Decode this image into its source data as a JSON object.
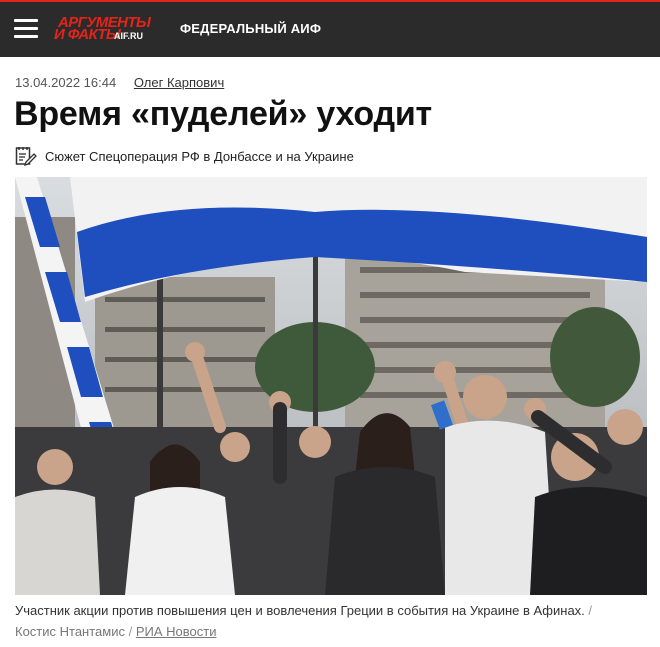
{
  "header": {
    "logo": {
      "line1": "АРГУМЕНТЫ",
      "line2": "И ФАКТЫ",
      "domain": "AIF.RU"
    },
    "section_link": "ФЕДЕРАЛЬНЫЙ АИФ",
    "icons": {
      "menu": "hamburger-menu-icon"
    }
  },
  "article": {
    "date": "13.04.2022 16:44",
    "author": "Олег Карпович",
    "title": "Время «пуделей» уходит",
    "story_label": "Сюжет Спецоперация РФ в Донбассе и на Украине",
    "story_icon": "story-notepad-icon",
    "caption": {
      "text": "Участник акции против повышения цен и вовлечения Греции в события на Украине в Афинах.",
      "separator": "/",
      "credit": "Костис Нтантамис",
      "source": "РИА Новости"
    }
  },
  "colors": {
    "brand_red": "#e4241b",
    "topbar": "#2b2b2b",
    "flag_blue": "#1f4fbf"
  }
}
